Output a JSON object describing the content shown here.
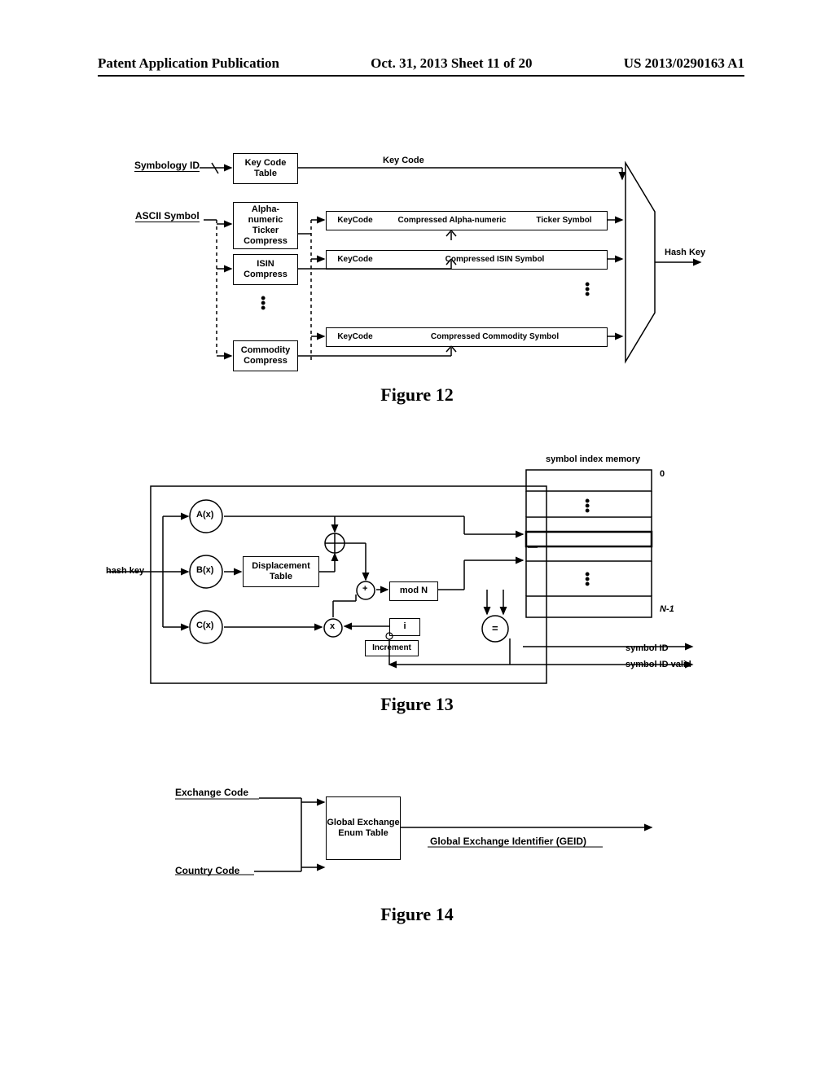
{
  "header": {
    "left": "Patent Application Publication",
    "center": "Oct. 31, 2013  Sheet 11 of 20",
    "right": "US 2013/0290163 A1"
  },
  "fig12": {
    "inputs": {
      "symbology_id": "Symbology ID",
      "ascii_symbol": "ASCII Symbol"
    },
    "boxes": {
      "key_code_table": "Key Code\nTable",
      "alpha_compress": "Alpha-\nnumeric\nTicker\nCompress",
      "isin_compress": "ISIN\nCompress",
      "commodity_compress": "Commodity\nCompress"
    },
    "key_code_top": "Key Code",
    "rows": {
      "r1_left": "KeyCode",
      "r1_mid": "Compressed Alpha-numeric",
      "r1_right": "Ticker Symbol",
      "r2_left": "KeyCode",
      "r2_right": "Compressed ISIN Symbol",
      "r3_left": "KeyCode",
      "r3_right": "Compressed Commodity Symbol"
    },
    "output": "Hash Key",
    "caption": "Figure 12"
  },
  "fig13": {
    "input": "hash key",
    "nodes": {
      "a": "A(x)",
      "b": "B(x)",
      "c": "C(x)"
    },
    "boxes": {
      "displacement": "Displacement\nTable",
      "modn": "mod N",
      "i": "i",
      "increment": "Increment"
    },
    "memory_label": "symbol index memory",
    "memory_top": "0",
    "memory_bottom": "N-1",
    "outputs": {
      "id": "symbol ID",
      "valid": "symbol ID valid"
    },
    "ops": {
      "xor": "⊕",
      "plus": "+",
      "mul": "x",
      "eq": "="
    },
    "caption": "Figure 13"
  },
  "fig14": {
    "inputs": {
      "exchange": "Exchange Code",
      "country": "Country Code"
    },
    "box": "Global\nExchange\nEnum\nTable",
    "output": "Global Exchange Identifier  (GEID)",
    "caption": "Figure 14"
  }
}
